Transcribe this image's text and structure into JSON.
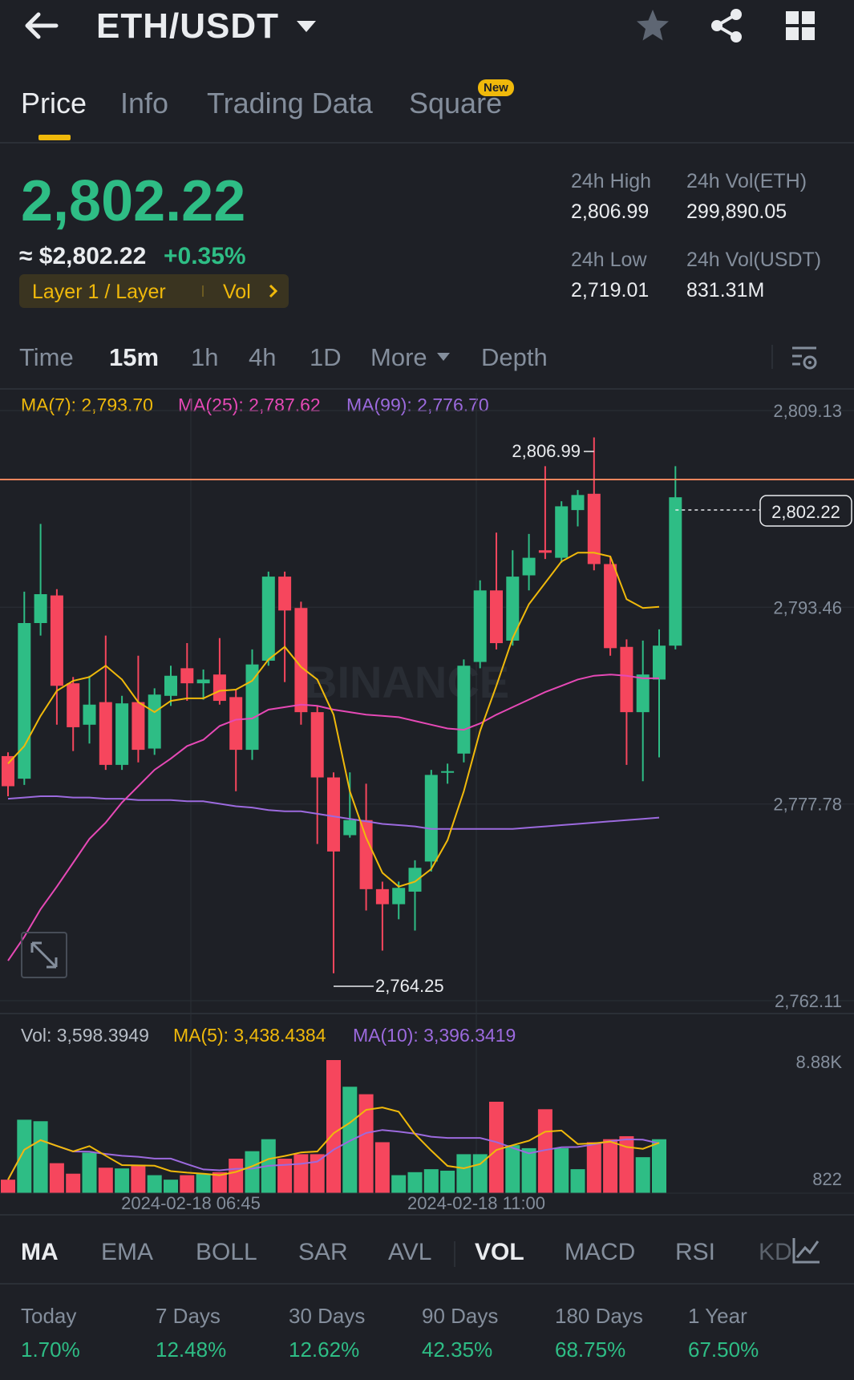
{
  "header": {
    "title": "ETH/USDT",
    "icons": [
      "back-arrow-icon",
      "dropdown-caret-icon",
      "star-icon",
      "share-icon",
      "grid-icon"
    ]
  },
  "tabs": [
    {
      "label": "Price",
      "active": true
    },
    {
      "label": "Info",
      "active": false
    },
    {
      "label": "Trading Data",
      "active": false
    },
    {
      "label": "Square",
      "active": false,
      "badge": "New"
    }
  ],
  "ticker": {
    "last_price": "2,802.22",
    "usd_price": "≈ $2,802.22",
    "change": "+0.35%",
    "tag_left": "Layer 1 / Layer",
    "tag_right": "Vol",
    "high_label": "24h High",
    "high_value": "2,806.99",
    "low_label": "24h Low",
    "low_value": "2,719.01",
    "vol_eth_label": "24h Vol(ETH)",
    "vol_eth_value": "299,890.05",
    "vol_usdt_label": "24h Vol(USDT)",
    "vol_usdt_value": "831.31M"
  },
  "intervals": [
    {
      "label": "Time",
      "active": false
    },
    {
      "label": "15m",
      "active": true
    },
    {
      "label": "1h",
      "active": false
    },
    {
      "label": "4h",
      "active": false
    },
    {
      "label": "1D",
      "active": false
    },
    {
      "label": "More",
      "active": false
    },
    {
      "label": "Depth",
      "active": false
    }
  ],
  "ma_legend": {
    "ma7": "MA(7): 2,793.70",
    "ma25": "MA(25): 2,787.62",
    "ma99": "MA(99): 2,776.70"
  },
  "vol_legend": {
    "vol": "Vol: 3,598.3949",
    "ma5": "MA(5): 3,438.4384",
    "ma10": "MA(10): 3,396.3419"
  },
  "colors": {
    "up": "#2ebd85",
    "down": "#f6465d",
    "ma7": "#f0b90b",
    "ma25": "#e649b6",
    "ma99": "#9c6ade",
    "accent": "#f0b90b",
    "bg": "#1e2026"
  },
  "watermark": "BINANCE",
  "chart_data": {
    "type": "candlestick",
    "interval": "15m",
    "price_axis_labels": [
      "2,809.13",
      "2,793.46",
      "2,777.78",
      "2,762.11"
    ],
    "price_axis": [
      2809.13,
      2793.46,
      2777.78,
      2762.11
    ],
    "high_marker": "2,806.99",
    "high_marker_value": 2806.99,
    "low_marker": "2,764.25",
    "low_marker_value": 2764.25,
    "last_price_label": "2,802.22",
    "last_price_value": 2802.22,
    "time_labels": [
      "2024-02-18 06:45",
      "2024-02-18 11:00"
    ],
    "candles": [
      {
        "o": 2781.6,
        "c": 2779.2,
        "h": 2781.9,
        "l": 2778.4
      },
      {
        "o": 2779.8,
        "c": 2792.2,
        "h": 2794.7,
        "l": 2779.3
      },
      {
        "o": 2792.2,
        "c": 2794.5,
        "h": 2800.1,
        "l": 2791.2
      },
      {
        "o": 2794.4,
        "c": 2787.2,
        "h": 2794.9,
        "l": 2784.1
      },
      {
        "o": 2787.4,
        "c": 2783.9,
        "h": 2787.9,
        "l": 2782.0
      },
      {
        "o": 2784.1,
        "c": 2785.7,
        "h": 2788.0,
        "l": 2782.6
      },
      {
        "o": 2785.9,
        "c": 2780.9,
        "h": 2791.2,
        "l": 2780.5
      },
      {
        "o": 2780.9,
        "c": 2785.8,
        "h": 2786.4,
        "l": 2780.5
      },
      {
        "o": 2785.9,
        "c": 2782.1,
        "h": 2789.6,
        "l": 2781.1
      },
      {
        "o": 2782.2,
        "c": 2786.5,
        "h": 2787.0,
        "l": 2781.7
      },
      {
        "o": 2786.4,
        "c": 2788.0,
        "h": 2788.8,
        "l": 2785.6
      },
      {
        "o": 2788.6,
        "c": 2787.4,
        "h": 2790.6,
        "l": 2786.0
      },
      {
        "o": 2787.4,
        "c": 2787.7,
        "h": 2788.5,
        "l": 2786.1
      },
      {
        "o": 2788.1,
        "c": 2786.0,
        "h": 2791.0,
        "l": 2785.7
      },
      {
        "o": 2786.3,
        "c": 2782.1,
        "h": 2786.9,
        "l": 2778.8
      },
      {
        "o": 2782.1,
        "c": 2788.9,
        "h": 2790.1,
        "l": 2781.3
      },
      {
        "o": 2789.2,
        "c": 2795.9,
        "h": 2796.3,
        "l": 2788.8
      },
      {
        "o": 2795.9,
        "c": 2793.2,
        "h": 2796.3,
        "l": 2787.5
      },
      {
        "o": 2793.4,
        "c": 2785.1,
        "h": 2793.9,
        "l": 2784.1
      },
      {
        "o": 2785.1,
        "c": 2779.9,
        "h": 2785.6,
        "l": 2774.6
      },
      {
        "o": 2779.9,
        "c": 2774.0,
        "h": 2780.3,
        "l": 2764.3
      },
      {
        "o": 2775.3,
        "c": 2776.5,
        "h": 2780.3,
        "l": 2775.1
      },
      {
        "o": 2776.5,
        "c": 2771.0,
        "h": 2779.4,
        "l": 2769.3
      },
      {
        "o": 2771.0,
        "c": 2769.8,
        "h": 2771.6,
        "l": 2766.1
      },
      {
        "o": 2769.8,
        "c": 2771.1,
        "h": 2771.6,
        "l": 2768.6
      },
      {
        "o": 2770.8,
        "c": 2772.7,
        "h": 2773.3,
        "l": 2767.7
      },
      {
        "o": 2773.2,
        "c": 2780.1,
        "h": 2780.5,
        "l": 2772.4
      },
      {
        "o": 2780.3,
        "c": 2780.4,
        "h": 2781.0,
        "l": 2779.4
      },
      {
        "o": 2781.8,
        "c": 2788.8,
        "h": 2789.3,
        "l": 2781.1
      },
      {
        "o": 2789.1,
        "c": 2794.8,
        "h": 2795.6,
        "l": 2788.6
      },
      {
        "o": 2794.8,
        "c": 2790.6,
        "h": 2799.4,
        "l": 2790.1
      },
      {
        "o": 2790.8,
        "c": 2795.9,
        "h": 2798.0,
        "l": 2790.4
      },
      {
        "o": 2796.0,
        "c": 2797.4,
        "h": 2799.3,
        "l": 2794.8
      },
      {
        "o": 2798.0,
        "c": 2797.8,
        "h": 2804.7,
        "l": 2797.3
      },
      {
        "o": 2797.4,
        "c": 2801.5,
        "h": 2801.9,
        "l": 2797.0
      },
      {
        "o": 2801.2,
        "c": 2802.4,
        "h": 2802.8,
        "l": 2799.9
      },
      {
        "o": 2802.5,
        "c": 2796.9,
        "h": 2806.99,
        "l": 2796.4
      },
      {
        "o": 2796.9,
        "c": 2790.2,
        "h": 2797.5,
        "l": 2789.6
      },
      {
        "o": 2790.3,
        "c": 2785.1,
        "h": 2790.9,
        "l": 2780.9
      },
      {
        "o": 2785.1,
        "c": 2788.1,
        "h": 2790.8,
        "l": 2779.6
      },
      {
        "o": 2787.7,
        "c": 2790.4,
        "h": 2791.7,
        "l": 2781.5
      },
      {
        "o": 2790.4,
        "c": 2802.22,
        "h": 2804.7,
        "l": 2790.1
      }
    ],
    "ma7": [
      2781.0,
      2782.4,
      2784.8,
      2786.8,
      2787.6,
      2787.9,
      2788.8,
      2787.7,
      2785.9,
      2785.1,
      2786.0,
      2786.2,
      2786.2,
      2786.8,
      2786.9,
      2787.6,
      2789.3,
      2790.3,
      2788.7,
      2787.7,
      2784.9,
      2778.8,
      2775.1,
      2772.3,
      2771.2,
      2771.6,
      2772.6,
      2774.9,
      2778.8,
      2783.6,
      2787.2,
      2791.0,
      2793.7,
      2795.4,
      2797.1,
      2797.8,
      2797.8,
      2797.5,
      2794.1,
      2793.4,
      2793.5
    ],
    "ma25": [
      2765.3,
      2767.2,
      2769.4,
      2771.2,
      2773.1,
      2775.0,
      2776.3,
      2777.9,
      2779.2,
      2780.5,
      2781.4,
      2782.4,
      2782.9,
      2784.0,
      2784.5,
      2784.6,
      2785.3,
      2785.5,
      2785.7,
      2785.6,
      2785.3,
      2785.1,
      2784.9,
      2784.8,
      2784.7,
      2784.4,
      2784.1,
      2783.8,
      2783.7,
      2784.2,
      2784.9,
      2785.5,
      2786.1,
      2786.7,
      2787.2,
      2787.7,
      2788.0,
      2788.1,
      2788.0,
      2787.8,
      2787.8
    ],
    "ma99": [
      2778.2,
      2778.3,
      2778.4,
      2778.4,
      2778.3,
      2778.3,
      2778.2,
      2778.2,
      2778.1,
      2778.1,
      2778.1,
      2778.0,
      2778.0,
      2777.8,
      2777.6,
      2777.5,
      2777.3,
      2777.2,
      2777.2,
      2777.0,
      2776.8,
      2776.6,
      2776.4,
      2776.2,
      2776.1,
      2776.0,
      2775.8,
      2775.8,
      2775.8,
      2775.8,
      2775.8,
      2775.8,
      2775.9,
      2776.0,
      2776.1,
      2776.2,
      2776.3,
      2776.4,
      2776.5,
      2776.6,
      2776.7
    ],
    "volume_axis_labels": [
      "8.88K",
      "822"
    ],
    "volume_axis": [
      8880,
      822
    ],
    "volumes": [
      900,
      4900,
      4800,
      2000,
      1300,
      2700,
      1700,
      1650,
      1900,
      1200,
      900,
      1200,
      1300,
      1400,
      2300,
      2800,
      3600,
      2300,
      2600,
      2600,
      8880,
      7100,
      6600,
      3400,
      1200,
      1400,
      1600,
      1500,
      2600,
      2600,
      6100,
      3200,
      3000,
      5600,
      3000,
      1600,
      3400,
      3600,
      3800,
      2400,
      3598
    ]
  },
  "indicators": [
    {
      "label": "MA",
      "active": true
    },
    {
      "label": "EMA",
      "active": false
    },
    {
      "label": "BOLL",
      "active": false
    },
    {
      "label": "SAR",
      "active": false
    },
    {
      "label": "AVL",
      "active": false
    },
    {
      "label": "VOL",
      "active": true
    },
    {
      "label": "MACD",
      "active": false
    },
    {
      "label": "RSI",
      "active": false
    },
    {
      "label": "KD",
      "active": false
    }
  ],
  "performance": [
    {
      "label": "Today",
      "value": "1.70%"
    },
    {
      "label": "7 Days",
      "value": "12.48%"
    },
    {
      "label": "30 Days",
      "value": "12.62%"
    },
    {
      "label": "90 Days",
      "value": "42.35%"
    },
    {
      "label": "180 Days",
      "value": "68.75%"
    },
    {
      "label": "1 Year",
      "value": "67.50%"
    }
  ]
}
